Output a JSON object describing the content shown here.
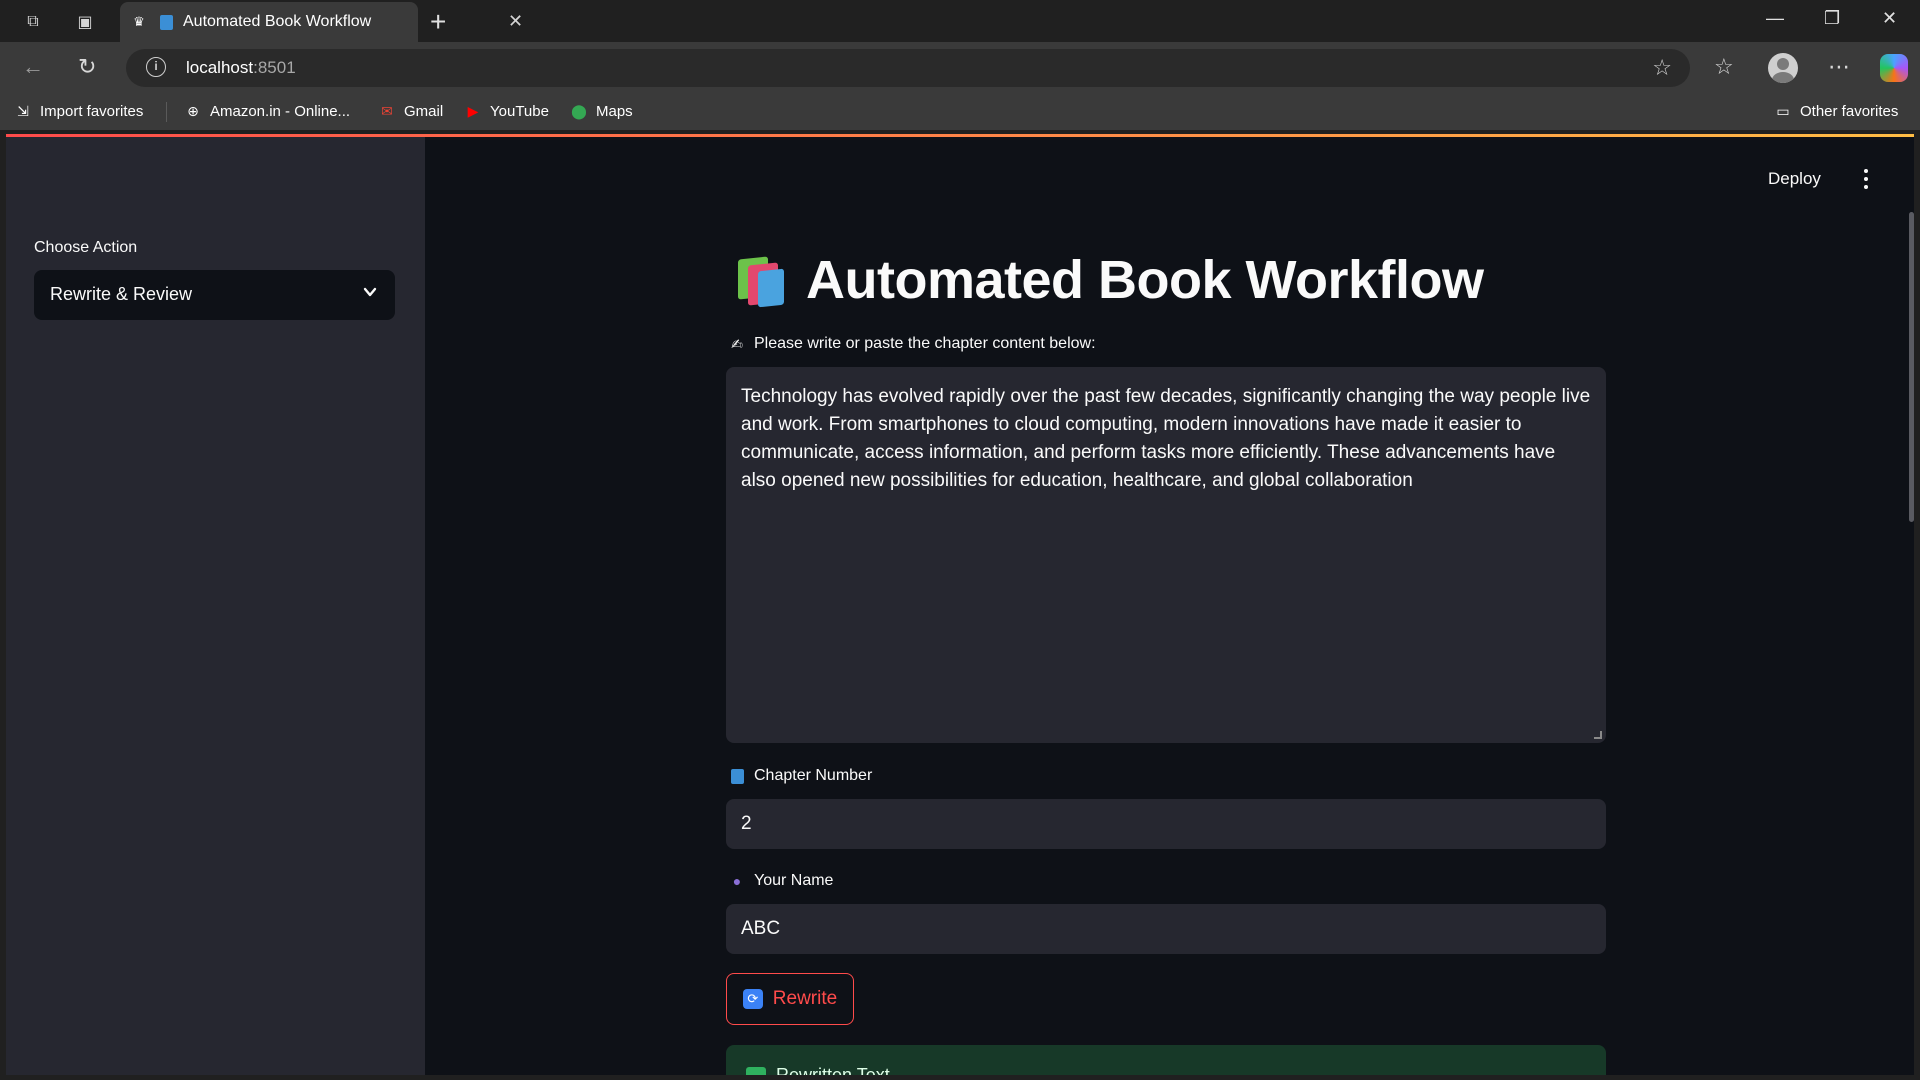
{
  "browser": {
    "tab_title": "Automated Book Workflow",
    "url_host": "localhost",
    "url_port": ":8501",
    "bookmarks": [
      {
        "label": "Import favorites",
        "icon": "import-icon"
      },
      {
        "label": "Amazon.in - Online...",
        "icon": "globe-icon"
      },
      {
        "label": "Gmail",
        "icon": "gmail-icon"
      },
      {
        "label": "YouTube",
        "icon": "youtube-icon"
      },
      {
        "label": "Maps",
        "icon": "maps-icon"
      }
    ],
    "other_favorites": "Other favorites"
  },
  "app": {
    "deploy_label": "Deploy",
    "sidebar": {
      "choose_action_label": "Choose Action",
      "selected_action": "Rewrite & Review"
    },
    "title": "Automated Book Workflow",
    "content_label": "Please write or paste the chapter content below:",
    "content_value": "Technology has evolved rapidly over the past few decades, significantly changing the way people live and work. From smartphones to cloud computing, modern innovations have made it easier to communicate, access information, and perform tasks more efficiently. These advancements have also opened new possibilities for education, healthcare, and global collaboration",
    "chapter_label": "Chapter Number",
    "chapter_value": "2",
    "name_label": "Your Name",
    "name_value": "ABC",
    "rewrite_button": "Rewrite",
    "result_heading": "Rewritten Text"
  },
  "colors": {
    "accent": "#ff4b4b",
    "app_bg": "#0e1117",
    "sidebar_bg": "#262730",
    "success_bg": "#173928"
  }
}
